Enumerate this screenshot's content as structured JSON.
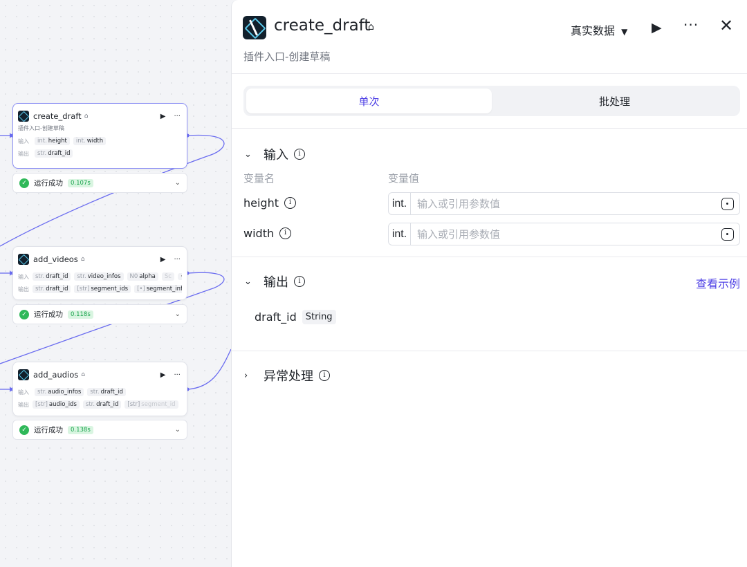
{
  "canvas": {
    "nodes": [
      {
        "title": "create_draft",
        "desc": "插件入口-创建草稿",
        "input_label": "输入",
        "output_label": "输出",
        "inputs": [
          {
            "type": "int.",
            "name": "height"
          },
          {
            "type": "int.",
            "name": "width"
          }
        ],
        "outputs": [
          {
            "type": "str.",
            "name": "draft_id"
          }
        ],
        "status": {
          "text": "运行成功",
          "duration": "0.107s"
        }
      },
      {
        "title": "add_videos",
        "input_label": "输入",
        "output_label": "输出",
        "inputs": [
          {
            "type": "str.",
            "name": "draft_id"
          },
          {
            "type": "str.",
            "name": "video_infos"
          },
          {
            "type": "N0",
            "name": "alpha"
          },
          {
            "type": "",
            "name": "Sc"
          }
        ],
        "outputs": [
          {
            "type": "str.",
            "name": "draft_id"
          },
          {
            "type": "[str]",
            "name": "segment_ids"
          },
          {
            "type": "[•]",
            "name": "segment_infos"
          }
        ],
        "status": {
          "text": "运行成功",
          "duration": "0.118s"
        }
      },
      {
        "title": "add_audios",
        "input_label": "输入",
        "output_label": "输出",
        "inputs": [
          {
            "type": "str.",
            "name": "audio_infos"
          },
          {
            "type": "str.",
            "name": "draft_id"
          }
        ],
        "outputs": [
          {
            "type": "[str]",
            "name": "audio_ids"
          },
          {
            "type": "str.",
            "name": "draft_id"
          },
          {
            "type": "[str]",
            "name": "segment_id"
          }
        ],
        "status": {
          "text": "运行成功",
          "duration": "0.138s"
        }
      }
    ]
  },
  "panel": {
    "title": "create_draft",
    "subtitle": "插件入口-创建草稿",
    "data_source": "真实数据",
    "tabs": [
      "单次",
      "批处理"
    ],
    "input_section": {
      "title": "输入",
      "col_name": "变量名",
      "col_value": "变量值",
      "rows": [
        {
          "name": "height",
          "type": "int.",
          "placeholder": "输入或引用参数值"
        },
        {
          "name": "width",
          "type": "int.",
          "placeholder": "输入或引用参数值"
        }
      ]
    },
    "output_section": {
      "title": "输出",
      "link": "查看示例",
      "name": "draft_id",
      "type": "String"
    },
    "error_section": {
      "title": "异常处理"
    }
  },
  "colors": {
    "accent": "#4e40e5",
    "success": "#2fb859",
    "edge": "#6a6cf0"
  }
}
